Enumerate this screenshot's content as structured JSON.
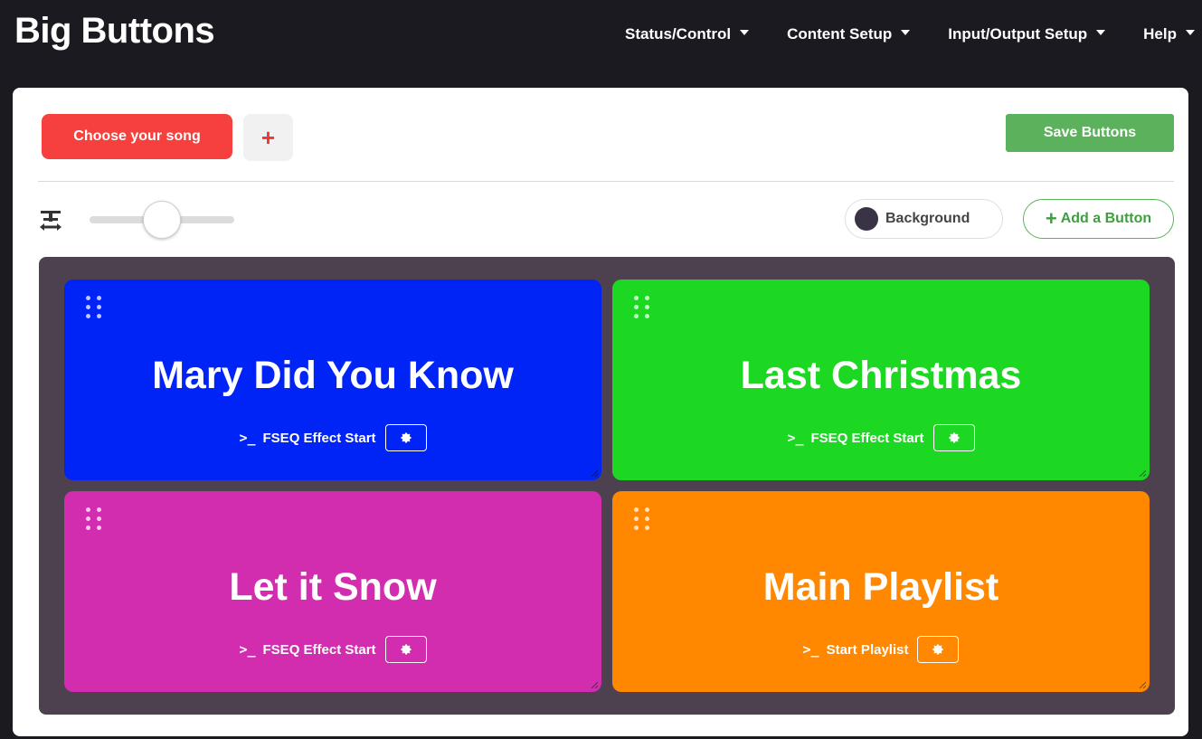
{
  "app": {
    "title": "Big Buttons"
  },
  "nav": [
    {
      "label": "Status/Control"
    },
    {
      "label": "Content Setup"
    },
    {
      "label": "Input/Output Setup"
    },
    {
      "label": "Help"
    }
  ],
  "toolbar": {
    "song_label": "Choose your song",
    "add_page_label": "+",
    "save_label": "Save Buttons",
    "background_label": "Background",
    "add_button_label": "Add a Button",
    "text_size_level": 0.5
  },
  "colors": {
    "nav_bg": "#1b1a20",
    "song_button": "#f5403d",
    "save_button": "#5cb25c",
    "grid_background": "#4e414f",
    "swatch": "#3a3346"
  },
  "buttons": [
    {
      "title": "Mary Did You Know",
      "action": "FSEQ Effect Start",
      "color": "#0024f5"
    },
    {
      "title": "Last Christmas",
      "action": "FSEQ Effect Start",
      "color": "#1dd823"
    },
    {
      "title": "Let it Snow",
      "action": "FSEQ Effect Start",
      "color": "#d22caf"
    },
    {
      "title": "Main Playlist",
      "action": "Start Playlist",
      "color": "#ff8800"
    }
  ]
}
